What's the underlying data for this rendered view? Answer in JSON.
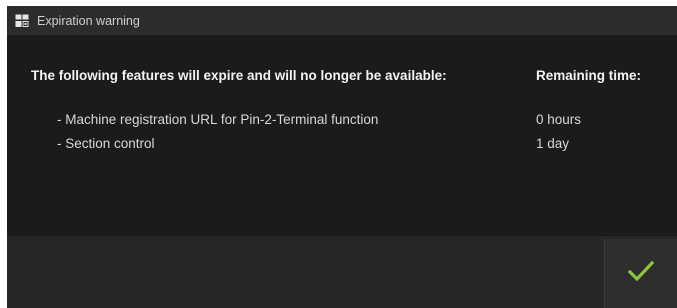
{
  "dialog": {
    "title": "Expiration warning",
    "heading": "The following features will expire and will no longer be available:",
    "remaining_heading": "Remaining time:",
    "features": [
      {
        "label": "- Machine registration URL for Pin-2-Terminal function",
        "remaining": "0 hours"
      },
      {
        "label": "- Section control",
        "remaining": "1 day"
      }
    ]
  },
  "icons": {
    "title_icon": "license-icon",
    "confirm_icon": "checkmark-icon"
  },
  "colors": {
    "background": "#1b1b1b",
    "title_bar": "#2c2c2c",
    "footer": "#262626",
    "confirm_check": "#8cc63f"
  }
}
